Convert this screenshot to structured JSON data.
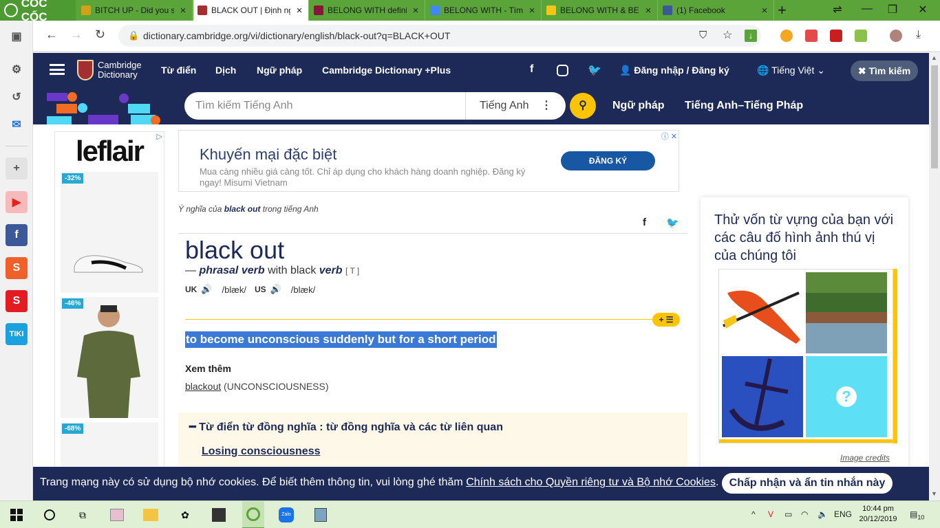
{
  "browser": {
    "logo_text": "CỐC CỐC",
    "tabs": [
      {
        "title": "BITCH UP - Did you s",
        "favicon_color": "#d4a017",
        "active": false
      },
      {
        "title": "BLACK OUT | Định ng",
        "favicon_color": "#a42f33",
        "active": true
      },
      {
        "title": "BELONG WITH defini",
        "favicon_color": "#8b1538",
        "active": false
      },
      {
        "title": "BELONG WITH - Tìm",
        "favicon_color": "#4285f4",
        "active": false
      },
      {
        "title": "BELONG WITH & BEL",
        "favicon_color": "#f5c518",
        "active": false
      },
      {
        "title": "(1) Facebook",
        "favicon_color": "#3b5998",
        "active": false
      }
    ],
    "url": "dictionary.cambridge.org/vi/dictionary/english/black-out?q=BLACK+OUT"
  },
  "sidebar": {
    "items": [
      {
        "name": "panel-icon",
        "glyph": "▣"
      },
      {
        "name": "settings-icon",
        "glyph": "⚙"
      },
      {
        "name": "history-icon",
        "glyph": "↺"
      },
      {
        "name": "messenger-icon",
        "glyph": "✉"
      },
      {
        "name": "add-icon",
        "glyph": "+"
      },
      {
        "name": "youtube-icon",
        "glyph": "▶"
      },
      {
        "name": "facebook-icon",
        "glyph": "f"
      },
      {
        "name": "shopee-icon",
        "glyph": "S"
      },
      {
        "name": "sendo-icon",
        "glyph": "S"
      },
      {
        "name": "tiki-icon",
        "glyph": "TIKI"
      }
    ]
  },
  "header": {
    "logo_line1": "Cambridge",
    "logo_line2": "Dictionary",
    "nav": [
      "Từ điển",
      "Dịch",
      "Ngữ pháp",
      "Cambridge Dictionary +Plus"
    ],
    "login": "Đăng nhập / Đăng ký",
    "language": "Tiếng Việt",
    "search_toggle": "Tìm kiếm"
  },
  "search": {
    "placeholder": "Tìm kiếm Tiếng Anh",
    "dictionary": "Tiếng Anh",
    "links": [
      "Ngữ pháp",
      "Tiếng Anh–Tiếng Pháp"
    ]
  },
  "left_ad": {
    "brand": "leflair",
    "discounts": [
      "-32%",
      "-46%",
      "-68%"
    ]
  },
  "top_ad": {
    "headline": "Khuyến mại đặc biệt",
    "description": "Mua càng nhiều giá càng tốt. Chỉ áp dụng cho khách hàng doanh nghiệp. Đăng ký ngay! Misumi Vietnam",
    "cta": "ĐĂNG KÝ"
  },
  "entry": {
    "meaning_prefix": "Ý nghĩa của",
    "meaning_word": "black out",
    "meaning_suffix": "trong tiếng Anh",
    "headword": "black out",
    "pos": "phrasal verb",
    "with": "with black",
    "verb": "verb",
    "grammar": "[ T ]",
    "uk_label": "UK",
    "uk_ipa": "/blæk/",
    "us_label": "US",
    "us_ipa": "/blæk/",
    "definition": "to become unconscious suddenly but for a short period",
    "see_also_heading": "Xem thêm",
    "see_also_word": "blackout",
    "see_also_note": "(UNCONSCIOUSNESS)",
    "thesaurus_heading": "Từ điển từ đồng nghĩa : từ đồng nghĩa và các từ liên quan",
    "thesaurus_link": "Losing consciousness"
  },
  "quiz": {
    "heading": "Thử vốn từ vựng của bạn với các câu đố hình ảnh thú vị của chúng tôi",
    "credits": "Image credits"
  },
  "cookie": {
    "message": "Trang mạng này có sử dụng bộ nhớ cookies. Để biết thêm thông tin, vui lòng ghé thăm",
    "link": "Chính sách cho Quyền riêng tư và Bộ nhớ Cookies",
    "accept": "Chấp nhận và ẩn tin nhắn này"
  },
  "taskbar": {
    "time": "10:44 pm",
    "date": "20/12/2019",
    "lang": "ENG",
    "notifications": "10"
  }
}
